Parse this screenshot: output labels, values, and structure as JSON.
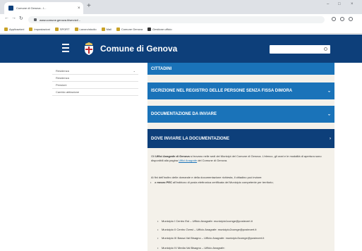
{
  "browser": {
    "tab_title": "Comune di Genova - I...",
    "tab_close": "×",
    "new_tab": "+",
    "window_controls": [
      "–",
      "□",
      "×"
    ],
    "nav": [
      "←",
      "→",
      "↻"
    ],
    "url": "www.comune.genova.it/servizi/...",
    "bookmarks": [
      "Applicazioni",
      "Impostazioni",
      "SPORT",
      "Lavoro/studio",
      "Mail",
      "Comune Genova",
      "Gestione ufficio"
    ]
  },
  "header": {
    "site_name": "Comune di Genova",
    "background_color": "#0d3f7a",
    "accent_color": "#1a73b9"
  },
  "sidebar": {
    "items": [
      {
        "label": "Residenza",
        "caret": "⌄"
      },
      {
        "label": "Residenza",
        "caret": ""
      },
      {
        "label": "Pensioni",
        "caret": ""
      },
      {
        "label": "Cambio abitazione",
        "caret": ""
      }
    ]
  },
  "main": {
    "accordion": [
      {
        "label": "CITTADINI",
        "chevron": ""
      },
      {
        "label": "ISCRIZIONE NEL REGISTRO DELLE PERSONE SENZA FISSA DIMORA",
        "chevron": "⌄"
      },
      {
        "label": "DOCUMENTAZIONE DA INVIARE",
        "chevron": "⌄"
      },
      {
        "label": "DOVE INVIARE LA DOCUMENTAZIONE",
        "chevron": "›"
      }
    ],
    "para1_a": "Gli ",
    "para1_strong": "Uffici Anagrafe di Genova",
    "para1_b": " si trovano nelle sedi dei Municipi del Comune di Genova. L'elenco, gli orari e le modalità di apertura sono disponibili alla pagina ",
    "para1_link": "Uffici Anagrafe",
    "para1_c": " del Comune di Genova.",
    "para2": "Ai fini dell'inoltro delle domande e della documentazione richiesta, il cittadino può inviare:",
    "bullet_main_a": "a ",
    "bullet_main_strong": "mezzo PEC",
    "bullet_main_b": " all'indirizzo di posta elettronica certificata del Municipio competente per territorio;",
    "contacts": [
      {
        "prefix": "Municipio I Centro Est – Ufficio Anagrafe: ",
        "email": "municipio1comge@postecert.it"
      },
      {
        "prefix": "Municipio II Centro Ovest – Ufficio Anagrafe: ",
        "email": "municipio2comge@postecert.it"
      },
      {
        "prefix": "Municipio III Bassa Val Bisagno – Ufficio Anagrafe: ",
        "email": "municipio3comge@postecert.it"
      },
      {
        "prefix": "Municipio IV Media Val Bisagno – Ufficio Anagrafe: ",
        "email": ""
      }
    ]
  }
}
